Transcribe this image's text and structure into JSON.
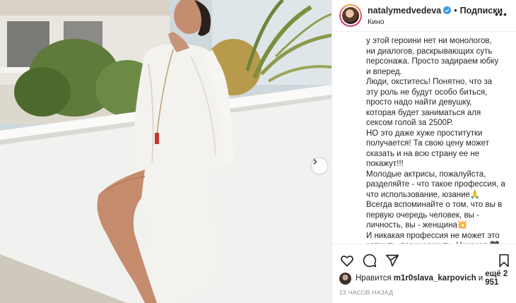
{
  "header": {
    "username": "natalymedvedeva",
    "separator": "•",
    "follow_label": "Подписки",
    "subtitle": "Кино",
    "more_label": "•••"
  },
  "caption": {
    "lines": [
      "у этой героини нет ни монологов,",
      "ни диалогов, раскрывающих суть",
      "персонажа. Просто задираем юбку",
      "и вперед.",
      "Люди, окститесь!  Понятно, что за",
      "эту роль не будут особо биться,",
      "просто надо найти девушку,",
      "которая будет заниматься аля",
      "сексом голой за 2500Р.",
      "НО это даже хуже проститутки",
      "получается! Та свою цену может",
      "сказать и на всю страну ее не",
      "покажут!!!",
      "Молодые актрисы, пожалуйста,",
      "разделяйте - что такое профессия, а",
      "что использование, юзание🙏",
      "Всегда вспоминайте о том, что вы в",
      "первую очередь человек,  вы -",
      "личность, вы - женщина💥",
      "И никакая профессия не может это",
      "затмить, перечеркнуть. Никакая 🖤"
    ]
  },
  "actions": {
    "like": "heart-icon",
    "comment": "comment-icon",
    "share": "share-icon",
    "save": "bookmark-icon"
  },
  "likes": {
    "prefix": "Нравится",
    "user": "m1r0slava_karpovich",
    "middle": "и",
    "others": "ещё 2 951"
  },
  "timestamp": "23 ЧАСОВ НАЗАД",
  "colors": {
    "text": "#262626",
    "muted": "#8e8e8e",
    "verified": "#3897f0",
    "divider": "#efefef"
  }
}
